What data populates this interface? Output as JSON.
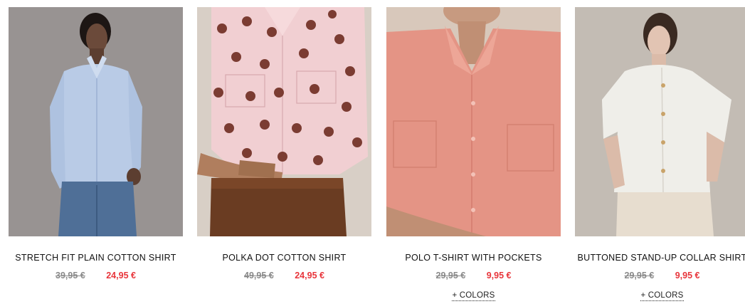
{
  "products": [
    {
      "name": "STRETCH FIT PLAIN COTTON SHIRT",
      "old_price": "39,95 €",
      "new_price": "24,95 €",
      "colors_link": ""
    },
    {
      "name": "POLKA DOT COTTON SHIRT",
      "old_price": "49,95 €",
      "new_price": "24,95 €",
      "colors_link": ""
    },
    {
      "name": "POLO T-SHIRT WITH POCKETS",
      "old_price": "29,95 €",
      "new_price": "9,95 €",
      "colors_link": "+ COLORS"
    },
    {
      "name": "BUTTONED STAND-UP COLLAR SHIRT",
      "old_price": "29,95 €",
      "new_price": "9,95 €",
      "colors_link": "+ COLORS"
    }
  ],
  "colors": {
    "sale_price": "#e8353b",
    "old_price": "#8a8a8a"
  }
}
